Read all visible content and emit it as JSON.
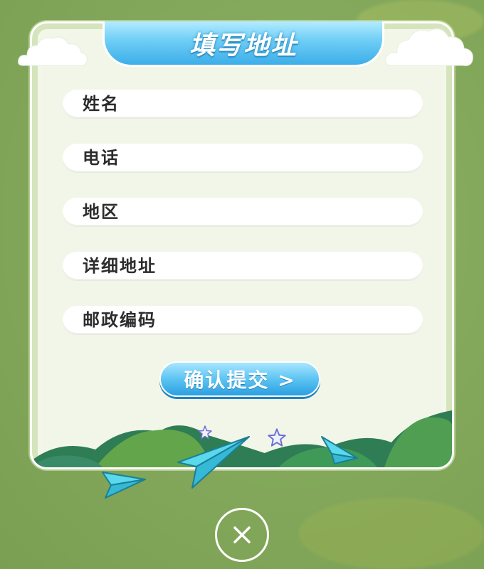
{
  "dialog": {
    "title": "填写地址",
    "fields": [
      {
        "label": "姓名",
        "value": ""
      },
      {
        "label": "电话",
        "value": ""
      },
      {
        "label": "地区",
        "value": ""
      },
      {
        "label": "详细地址",
        "value": ""
      },
      {
        "label": "邮政编码",
        "value": ""
      }
    ],
    "submit_label": "确认提交 >"
  },
  "icons": {
    "close": "close-icon",
    "decoration": [
      "cloud-icon",
      "paper-plane-icon",
      "star-icon",
      "bush-icon"
    ]
  },
  "colors": {
    "background": "#84a95c",
    "card": "#f3f7ea",
    "accent_blue": "#3daee9",
    "field_text": "#2c2c2c"
  }
}
